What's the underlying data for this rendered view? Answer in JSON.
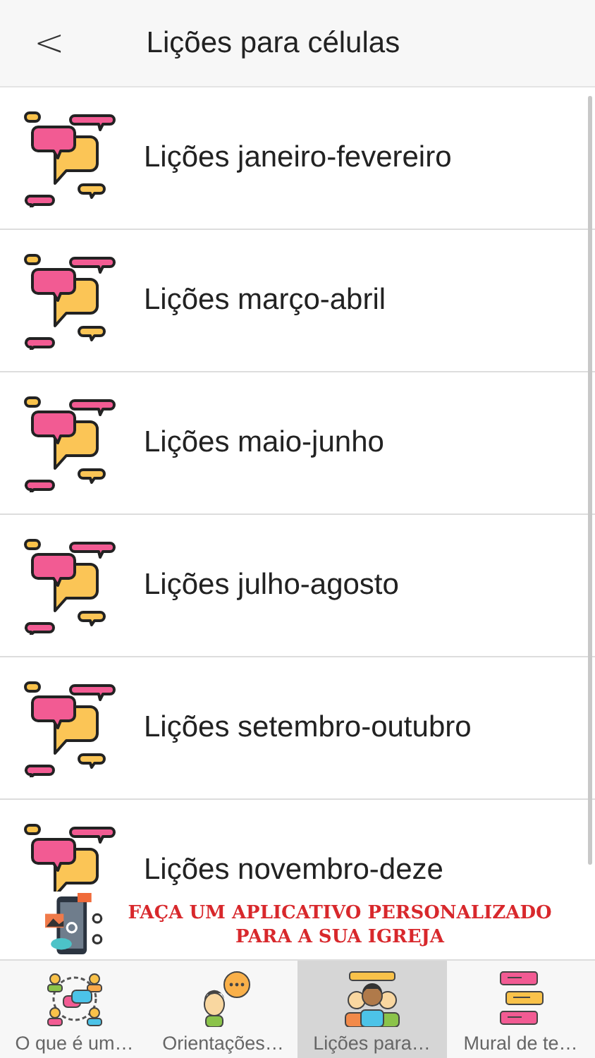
{
  "header": {
    "back": "<",
    "title": "Lições para células"
  },
  "lessons": [
    {
      "title": "Lições janeiro-fevereiro"
    },
    {
      "title": "Lições março-abril"
    },
    {
      "title": "Lições maio-junho"
    },
    {
      "title": "Lições julho-agosto"
    },
    {
      "title": "Lições setembro-outubro"
    },
    {
      "title": "Lições novembro-deze"
    }
  ],
  "banner": {
    "lines": [
      "FAÇA UM APLICATIVO PERSONALIZADO",
      "PARA A SUA IGREJA"
    ]
  },
  "tabs": [
    {
      "kind": "group",
      "label": "O que é um…",
      "selected": false
    },
    {
      "kind": "person",
      "label": "Orientações…",
      "selected": false
    },
    {
      "kind": "team",
      "label": "Lições para…",
      "selected": true
    },
    {
      "kind": "messages",
      "label": "Mural de te…",
      "selected": false
    }
  ]
}
